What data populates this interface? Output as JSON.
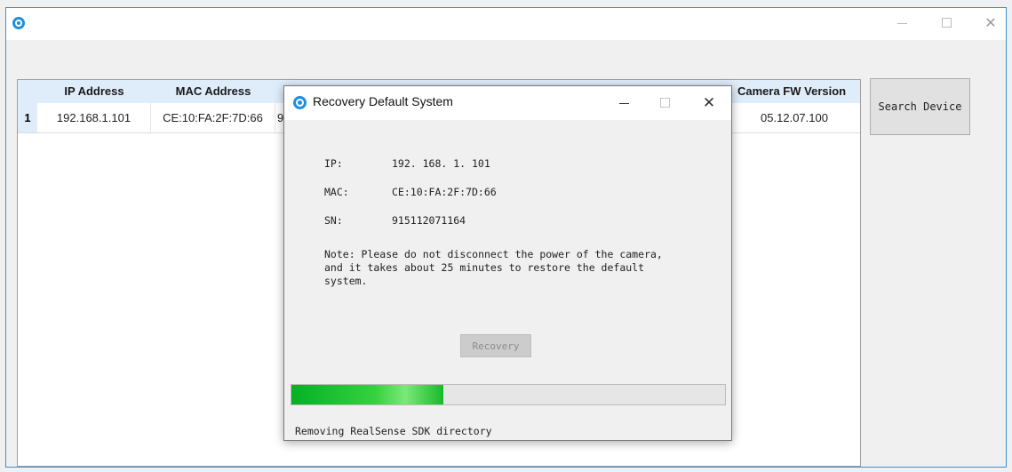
{
  "main_window": {
    "controls": {
      "minimize": "minimize",
      "maximize": "maximize",
      "close": "✕"
    }
  },
  "table": {
    "columns": [
      "IP Address",
      "MAC Address",
      "",
      "",
      "",
      "",
      "Camera FW Version"
    ],
    "rows": [
      {
        "index": "1",
        "cells": [
          "192.168.1.101",
          "CE:10:FA:2F:7D:66",
          "9",
          "",
          "",
          "",
          "05.12.07.100"
        ]
      }
    ]
  },
  "search_button": {
    "label": "Search Device"
  },
  "dialog": {
    "title": "Recovery Default System",
    "close": "✕",
    "fields": [
      {
        "label": "IP:",
        "value": "192. 168. 1. 101"
      },
      {
        "label": "MAC:",
        "value": "CE:10:FA:2F:7D:66"
      },
      {
        "label": "SN:",
        "value": "915112071164"
      }
    ],
    "note": "Note: Please do not disconnect the power of the camera,\nand it takes about 25 minutes to restore the default\nsystem.",
    "recovery_button": "Recovery",
    "progress": 0.35,
    "status": "Removing RealSense SDK directory"
  },
  "colors": {
    "accent": "#1f8fe0",
    "header_bg": "#dfecfa",
    "progress_green": "#06b025"
  }
}
